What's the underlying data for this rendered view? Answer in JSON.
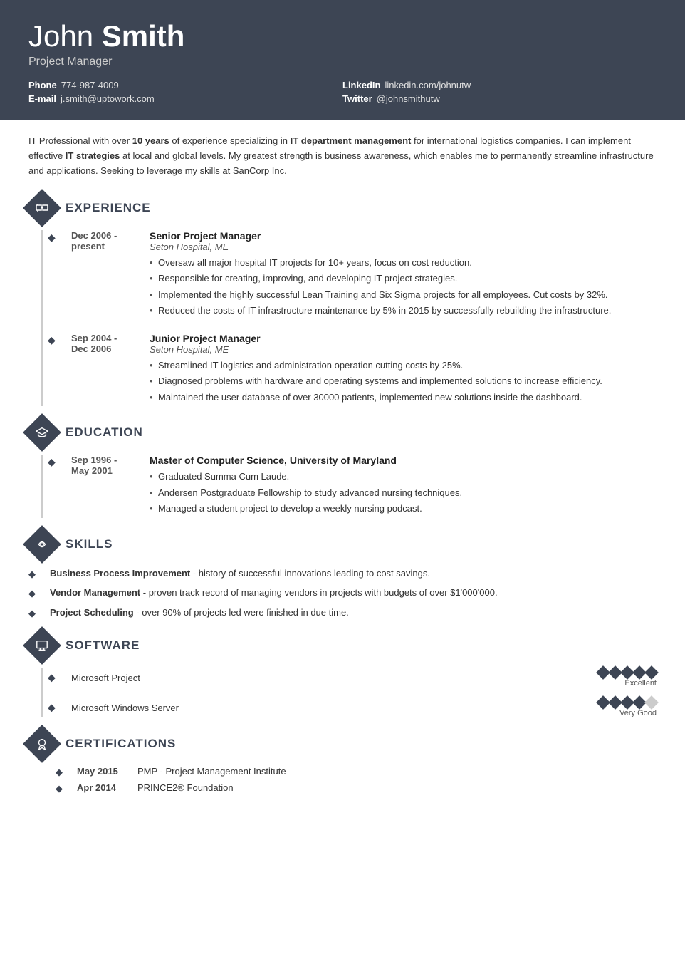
{
  "header": {
    "first_name": "John",
    "last_name": "Smith",
    "title": "Project Manager",
    "phone_label": "Phone",
    "phone_value": "774-987-4009",
    "email_label": "E-mail",
    "email_value": "j.smith@uptowork.com",
    "linkedin_label": "LinkedIn",
    "linkedin_value": "linkedin.com/johnutw",
    "twitter_label": "Twitter",
    "twitter_value": "@johnsmithutw"
  },
  "summary": {
    "text_before_bold1": "IT Professional with over ",
    "bold1": "10 years",
    "text_before_bold2": " of experience specializing in ",
    "bold2": "IT department management",
    "text_before_bold3": " for international logistics companies. I can implement effective ",
    "bold3": "IT strategies",
    "text_after": " at local and global levels. My greatest strength is business awareness, which enables me to permanently streamline infrastructure and applications. Seeking to leverage my skills at SanCorp Inc."
  },
  "sections": {
    "experience": {
      "title": "EXPERIENCE",
      "icon": "⚙",
      "jobs": [
        {
          "date": "Dec 2006 -\npresent",
          "title": "Senior Project Manager",
          "company": "Seton Hospital, ME",
          "bullets": [
            "Oversaw all major hospital IT projects for 10+ years, focus on cost reduction.",
            "Responsible for creating, improving, and developing IT project strategies.",
            "Implemented the highly successful Lean Training and Six Sigma projects for all employees. Cut costs by 32%.",
            "Reduced the costs of IT infrastructure maintenance by 5% in 2015 by successfully rebuilding the infrastructure."
          ]
        },
        {
          "date": "Sep 2004 -\nDec 2006",
          "title": "Junior Project Manager",
          "company": "Seton Hospital, ME",
          "bullets": [
            "Streamlined IT logistics and administration operation cutting costs by 25%.",
            "Diagnosed problems with hardware and operating systems and implemented solutions to increase efficiency.",
            "Maintained the user database of over 30000 patients, implemented new solutions inside the dashboard."
          ]
        }
      ]
    },
    "education": {
      "title": "EDUCATION",
      "icon": "🎓",
      "items": [
        {
          "date": "Sep 1996 -\nMay 2001",
          "degree": "Master of Computer Science, University of Maryland",
          "bullets": [
            "Graduated Summa Cum Laude.",
            "Andersen Postgraduate Fellowship to study advanced nursing techniques.",
            "Managed a student project to develop a weekly nursing podcast."
          ]
        }
      ]
    },
    "skills": {
      "title": "SKILLS",
      "icon": "✦",
      "items": [
        {
          "name": "Business Process Improvement",
          "desc": " - history of successful innovations leading to cost savings."
        },
        {
          "name": "Vendor Management",
          "desc": " - proven track record of managing vendors in projects with budgets of over $1'000'000."
        },
        {
          "name": "Project Scheduling",
          "desc": " - over 90% of projects led were finished in due time."
        }
      ]
    },
    "software": {
      "title": "SOFTWARE",
      "icon": "🖥",
      "items": [
        {
          "name": "Microsoft Project",
          "rating": 5,
          "max": 5,
          "label": "Excellent"
        },
        {
          "name": "Microsoft Windows Server",
          "rating": 4,
          "max": 5,
          "label": "Very Good"
        }
      ]
    },
    "certifications": {
      "title": "CERTIFICATIONS",
      "icon": "🏆",
      "items": [
        {
          "date": "May 2015",
          "name": "PMP - Project Management Institute"
        },
        {
          "date": "Apr 2014",
          "name": "PRINCE2® Foundation"
        }
      ]
    }
  }
}
